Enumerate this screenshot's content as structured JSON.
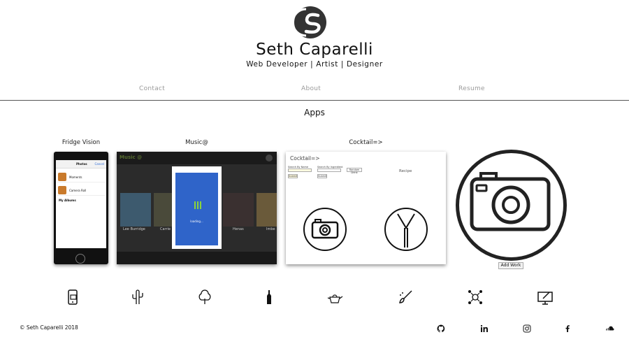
{
  "brand": {
    "name": "Seth Caparelli",
    "tagline": "Web Developer | Artist | Designer"
  },
  "nav": {
    "items": [
      {
        "label": "Contact"
      },
      {
        "label": "About"
      },
      {
        "label": "Resume"
      }
    ]
  },
  "apps": {
    "title": "Apps",
    "cards": [
      {
        "label": "Fridge Vision",
        "screenshot": {
          "header": "Photos",
          "header_action": "Cancel",
          "rows": [
            "Moments",
            "Camera Roll"
          ],
          "section": "My Albums"
        }
      },
      {
        "label": "Music@",
        "screenshot": {
          "logo": "Music @",
          "tiles": [
            "Lee Burridge",
            "Carrie",
            "Henas",
            "Imbe"
          ],
          "loading_text": "loading..."
        }
      },
      {
        "label": "Cocktail=>",
        "screenshot": {
          "title": "Cocktail=>",
          "search_name_label": "Search By Name",
          "search_ingredient_label": "Search By Ingredient",
          "random_label": "Random Drink",
          "submit_label": "Submit",
          "recipe_label": "Recipe"
        }
      }
    ],
    "add_work_label": "Add Work"
  },
  "skills_icons": [
    "mobile-app-icon",
    "cactus-icon",
    "tree-icon",
    "bottle-icon",
    "teapot-icon",
    "paintbrush-icon",
    "network-icon",
    "drawing-tablet-icon"
  ],
  "footer": {
    "copyright": "© Seth Caparelli 2018",
    "social": [
      "github-icon",
      "linkedin-icon",
      "instagram-icon",
      "facebook-icon",
      "soundcloud-icon"
    ]
  }
}
